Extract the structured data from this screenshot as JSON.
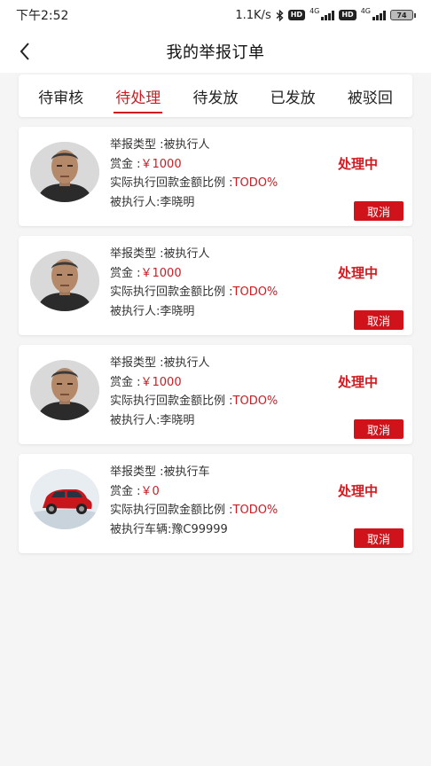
{
  "status_bar": {
    "time": "下午2:52",
    "net_speed": "1.1K/s",
    "hd1": "HD",
    "net1": "4G",
    "hd2": "HD",
    "net2": "4G",
    "battery": "74"
  },
  "header": {
    "title": "我的举报订单",
    "back_icon": "chevron-left-icon"
  },
  "tabs": [
    {
      "label": "待审核",
      "active": false
    },
    {
      "label": "待处理",
      "active": true
    },
    {
      "label": "待发放",
      "active": false
    },
    {
      "label": "已发放",
      "active": false
    },
    {
      "label": "被驳回",
      "active": false
    }
  ],
  "colors": {
    "accent": "#d01b22",
    "background": "#f5f5f5",
    "card": "#ffffff"
  },
  "orders": [
    {
      "image": "person-photo",
      "type_label": "举报类型 :",
      "type_value": "被执行人",
      "reward_label": "赏金 :",
      "reward_value": "￥1000",
      "ratio_label": "实际执行回款金额比例 :",
      "ratio_value": "TODO%",
      "target_label": "被执行人:",
      "target_value": "李晓明",
      "status": "处理中",
      "cancel_label": "取消"
    },
    {
      "image": "person-photo",
      "type_label": "举报类型 :",
      "type_value": "被执行人",
      "reward_label": "赏金 :",
      "reward_value": "￥1000",
      "ratio_label": "实际执行回款金额比例 :",
      "ratio_value": "TODO%",
      "target_label": "被执行人:",
      "target_value": "李晓明",
      "status": "处理中",
      "cancel_label": "取消"
    },
    {
      "image": "person-photo",
      "type_label": "举报类型 :",
      "type_value": "被执行人",
      "reward_label": "赏金 :",
      "reward_value": "￥1000",
      "ratio_label": "实际执行回款金额比例 :",
      "ratio_value": "TODO%",
      "target_label": "被执行人:",
      "target_value": "李晓明",
      "status": "处理中",
      "cancel_label": "取消"
    },
    {
      "image": "car-photo",
      "type_label": "举报类型 :",
      "type_value": "被执行车",
      "reward_label": "赏金 :",
      "reward_value": "￥0",
      "ratio_label": "实际执行回款金额比例 :",
      "ratio_value": "TODO%",
      "target_label": "被执行车辆:",
      "target_value": "豫C99999",
      "status": "处理中",
      "cancel_label": "取消"
    }
  ]
}
